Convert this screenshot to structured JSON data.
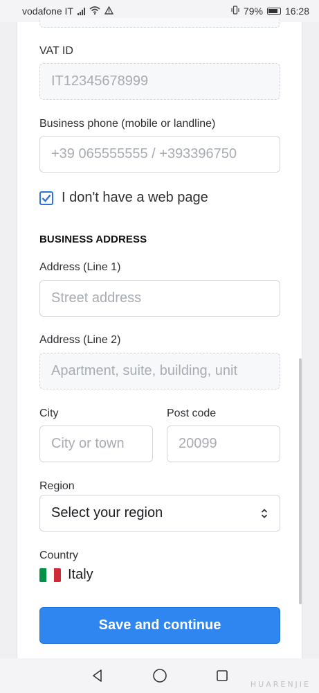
{
  "status_bar": {
    "carrier": "vodafone IT",
    "battery": "79%",
    "time": "16:28"
  },
  "form": {
    "vat": {
      "label": "VAT ID",
      "placeholder": "IT12345678999"
    },
    "phone": {
      "label": "Business phone (mobile or landline)",
      "placeholder": "+39 065555555 / +393396750"
    },
    "no_webpage": {
      "label": "I don't have a web page",
      "checked": true
    },
    "address_heading": "BUSINESS ADDRESS",
    "address1": {
      "label": "Address (Line 1)",
      "placeholder": "Street address"
    },
    "address2": {
      "label": "Address (Line 2)",
      "placeholder": "Apartment, suite, building, unit"
    },
    "city": {
      "label": "City",
      "placeholder": "City or town"
    },
    "postcode": {
      "label": "Post code",
      "placeholder": "20099"
    },
    "region": {
      "label": "Region",
      "selected": "Select your region"
    },
    "country": {
      "label": "Country",
      "name": "Italy",
      "flag_colors": [
        "#009246",
        "#ffffff",
        "#ce2b37"
      ]
    },
    "submit_label": "Save and continue"
  },
  "nav": {
    "icons": [
      "back-icon",
      "home-icon",
      "recents-icon"
    ]
  },
  "watermark": "HUARENJIE"
}
